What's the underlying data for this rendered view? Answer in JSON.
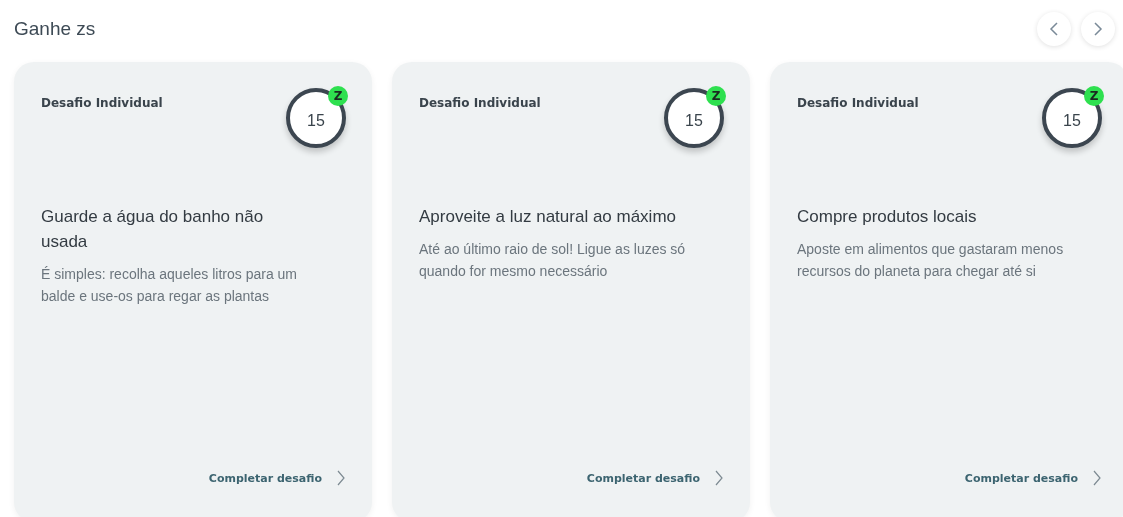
{
  "section_title": "Ganhe zs",
  "cards": [
    {
      "type": "Desafio Individual",
      "points": "15",
      "badge": "Z",
      "title": "Guarde a água do banho não usada",
      "description": "É simples: recolha aqueles litros para um balde e use-os para regar as plantas",
      "action": "Completar desafio"
    },
    {
      "type": "Desafio Individual",
      "points": "15",
      "badge": "Z",
      "title": "Aproveite a luz natural ao máximo",
      "description": "Até ao último raio de sol! Ligue as luzes só quando for mesmo necessário",
      "action": "Completar desafio"
    },
    {
      "type": "Desafio Individual",
      "points": "15",
      "badge": "Z",
      "title": "Compre produtos locais",
      "description": "Aposte em alimentos que gastaram menos recursos do planeta para chegar até si",
      "action": "Completar desafio"
    }
  ]
}
